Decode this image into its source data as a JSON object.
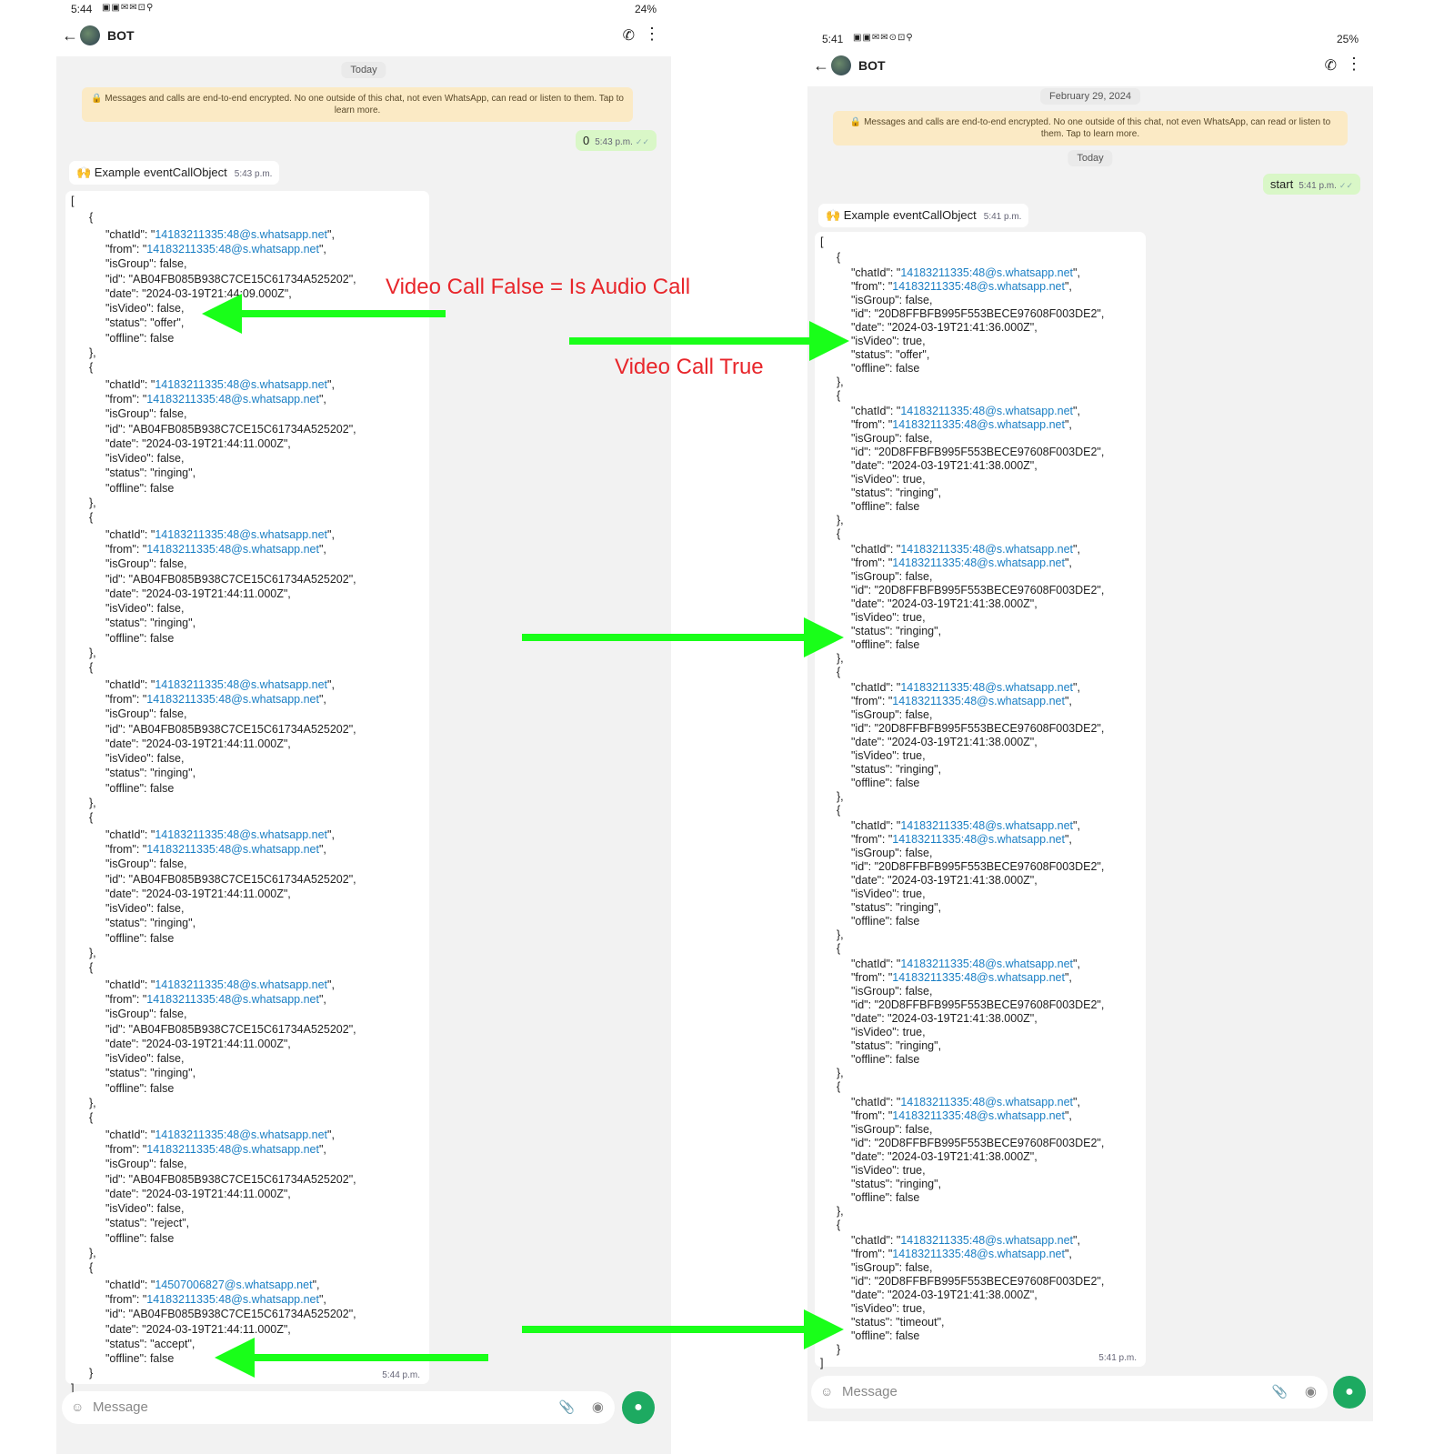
{
  "left": {
    "status_time": "5:44",
    "status_icons": "▣▣✉✉⊡⚲",
    "battery": "24%",
    "chat_title": "BOT",
    "date_chip": "Today",
    "notice": "🔒 Messages and calls are end-to-end encrypted. No one outside of this chat, not even WhatsApp, can read or listen to them. Tap to learn more.",
    "out_text": "0",
    "out_time": "5:43 p.m.",
    "in_title": "🙌 Example eventCallObject",
    "in_time": "5:43 p.m.",
    "objects": [
      {
        "chatId": "14183211335:48@s.whatsapp.net",
        "from": "14183211335:48@s.whatsapp.net",
        "isGroup": "false",
        "id": "AB04FB085B938C7CE15C61734A525202",
        "date": "2024-03-19T21:44:09.000Z",
        "isVideo": "false",
        "status": "offer",
        "offline": "false"
      },
      {
        "chatId": "14183211335:48@s.whatsapp.net",
        "from": "14183211335:48@s.whatsapp.net",
        "isGroup": "false",
        "id": "AB04FB085B938C7CE15C61734A525202",
        "date": "2024-03-19T21:44:11.000Z",
        "isVideo": "false",
        "status": "ringing",
        "offline": "false"
      },
      {
        "chatId": "14183211335:48@s.whatsapp.net",
        "from": "14183211335:48@s.whatsapp.net",
        "isGroup": "false",
        "id": "AB04FB085B938C7CE15C61734A525202",
        "date": "2024-03-19T21:44:11.000Z",
        "isVideo": "false",
        "status": "ringing",
        "offline": "false"
      },
      {
        "chatId": "14183211335:48@s.whatsapp.net",
        "from": "14183211335:48@s.whatsapp.net",
        "isGroup": "false",
        "id": "AB04FB085B938C7CE15C61734A525202",
        "date": "2024-03-19T21:44:11.000Z",
        "isVideo": "false",
        "status": "ringing",
        "offline": "false"
      },
      {
        "chatId": "14183211335:48@s.whatsapp.net",
        "from": "14183211335:48@s.whatsapp.net",
        "isGroup": "false",
        "id": "AB04FB085B938C7CE15C61734A525202",
        "date": "2024-03-19T21:44:11.000Z",
        "isVideo": "false",
        "status": "ringing",
        "offline": "false"
      },
      {
        "chatId": "14183211335:48@s.whatsapp.net",
        "from": "14183211335:48@s.whatsapp.net",
        "isGroup": "false",
        "id": "AB04FB085B938C7CE15C61734A525202",
        "date": "2024-03-19T21:44:11.000Z",
        "isVideo": "false",
        "status": "ringing",
        "offline": "false"
      },
      {
        "chatId": "14183211335:48@s.whatsapp.net",
        "from": "14183211335:48@s.whatsapp.net",
        "isGroup": "false",
        "id": "AB04FB085B938C7CE15C61734A525202",
        "date": "2024-03-19T21:44:11.000Z",
        "isVideo": "false",
        "status": "reject",
        "offline": "false"
      },
      {
        "chatId": "14507006827@s.whatsapp.net",
        "from": "14183211335:48@s.whatsapp.net",
        "id": "AB04FB085B938C7CE15C61734A525202",
        "date": "2024-03-19T21:44:11.000Z",
        "status": "accept",
        "offline": "false"
      }
    ],
    "bubble_time": "5:44 p.m.",
    "message_placeholder": "Message"
  },
  "right": {
    "status_time": "5:41",
    "status_icons": "▣▣✉✉⊙⊡⚲",
    "battery": "25%",
    "chat_title": "BOT",
    "date_chip_1": "February 29, 2024",
    "notice": "🔒 Messages and calls are end-to-end encrypted. No one outside of this chat, not even WhatsApp, can read or listen to them. Tap to learn more.",
    "date_chip_2": "Today",
    "out_text": "start",
    "out_time": "5:41 p.m.",
    "in_title": "🙌 Example eventCallObject",
    "in_time": "5:41 p.m.",
    "objects": [
      {
        "chatId": "14183211335:48@s.whatsapp.net",
        "from": "14183211335:48@s.whatsapp.net",
        "isGroup": "false",
        "id": "20D8FFBFB995F553BECE97608F003DE2",
        "date": "2024-03-19T21:41:36.000Z",
        "isVideo": "true",
        "status": "offer",
        "offline": "false"
      },
      {
        "chatId": "14183211335:48@s.whatsapp.net",
        "from": "14183211335:48@s.whatsapp.net",
        "isGroup": "false",
        "id": "20D8FFBFB995F553BECE97608F003DE2",
        "date": "2024-03-19T21:41:38.000Z",
        "isVideo": "true",
        "status": "ringing",
        "offline": "false"
      },
      {
        "chatId": "14183211335:48@s.whatsapp.net",
        "from": "14183211335:48@s.whatsapp.net",
        "isGroup": "false",
        "id": "20D8FFBFB995F553BECE97608F003DE2",
        "date": "2024-03-19T21:41:38.000Z",
        "isVideo": "true",
        "status": "ringing",
        "offline": "false"
      },
      {
        "chatId": "14183211335:48@s.whatsapp.net",
        "from": "14183211335:48@s.whatsapp.net",
        "isGroup": "false",
        "id": "20D8FFBFB995F553BECE97608F003DE2",
        "date": "2024-03-19T21:41:38.000Z",
        "isVideo": "true",
        "status": "ringing",
        "offline": "false"
      },
      {
        "chatId": "14183211335:48@s.whatsapp.net",
        "from": "14183211335:48@s.whatsapp.net",
        "isGroup": "false",
        "id": "20D8FFBFB995F553BECE97608F003DE2",
        "date": "2024-03-19T21:41:38.000Z",
        "isVideo": "true",
        "status": "ringing",
        "offline": "false"
      },
      {
        "chatId": "14183211335:48@s.whatsapp.net",
        "from": "14183211335:48@s.whatsapp.net",
        "isGroup": "false",
        "id": "20D8FFBFB995F553BECE97608F003DE2",
        "date": "2024-03-19T21:41:38.000Z",
        "isVideo": "true",
        "status": "ringing",
        "offline": "false"
      },
      {
        "chatId": "14183211335:48@s.whatsapp.net",
        "from": "14183211335:48@s.whatsapp.net",
        "isGroup": "false",
        "id": "20D8FFBFB995F553BECE97608F003DE2",
        "date": "2024-03-19T21:41:38.000Z",
        "isVideo": "true",
        "status": "ringing",
        "offline": "false"
      },
      {
        "chatId": "14183211335:48@s.whatsapp.net",
        "from": "14183211335:48@s.whatsapp.net",
        "isGroup": "false",
        "id": "20D8FFBFB995F553BECE97608F003DE2",
        "date": "2024-03-19T21:41:38.000Z",
        "isVideo": "true",
        "status": "timeout",
        "offline": "false"
      }
    ],
    "bubble_time": "5:41 p.m.",
    "message_placeholder": "Message"
  },
  "annotations": {
    "audio_label": "Video Call False = Is Audio Call",
    "video_label": "Video Call True",
    "color": "#e8262b",
    "arrow_color": "#19ff19"
  },
  "icons": {
    "back": "back-arrow-icon",
    "call": "add-call-icon",
    "menu": "more-vert-icon",
    "emoji": "emoji-icon",
    "attach": "attach-icon",
    "camera": "camera-icon",
    "mic": "mic-icon"
  }
}
